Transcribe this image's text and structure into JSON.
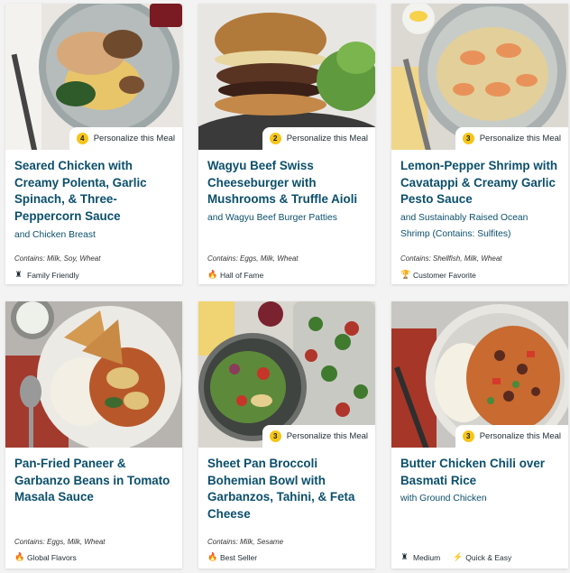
{
  "personalize_label": "Personalize this Meal",
  "colors": {
    "accent": "#0b4f6c",
    "badge": "#f5c518"
  },
  "meals": [
    {
      "count": "4",
      "title": "Seared Chicken with Creamy Polenta, Garlic Spinach, & Three-Peppercorn Sauce",
      "subtitle": "and Chicken Breast",
      "contains": "Contains: Milk, Soy, Wheat",
      "tags": [
        {
          "icon": "chef-hat-icon",
          "label": "Family Friendly"
        }
      ]
    },
    {
      "count": "2",
      "title": "Wagyu Beef Swiss Cheeseburger with Mushrooms & Truffle Aioli",
      "subtitle": "and Wagyu Beef Burger Patties",
      "contains": "Contains: Eggs, Milk, Wheat",
      "tags": [
        {
          "icon": "flame-icon",
          "label": "Hall of Fame"
        }
      ]
    },
    {
      "count": "3",
      "title": "Lemon-Pepper Shrimp with Cavatappi & Creamy Garlic Pesto Sauce",
      "subtitle": "and Sustainably Raised Ocean Shrimp (Contains: Sulfites)",
      "contains": "Contains: Shellfish, Milk, Wheat",
      "tags": [
        {
          "icon": "trophy-icon",
          "label": "Customer Favorite"
        }
      ]
    },
    {
      "count": "",
      "title": "Pan-Fried Paneer & Garbanzo Beans in Tomato Masala Sauce",
      "subtitle": "",
      "contains": "Contains: Eggs, Milk, Wheat",
      "tags": [
        {
          "icon": "flame-icon",
          "label": "Global Flavors"
        }
      ]
    },
    {
      "count": "3",
      "title": "Sheet Pan Broccoli Bohemian Bowl with Garbanzos, Tahini, & Feta Cheese",
      "subtitle": "",
      "contains": "Contains: Milk, Sesame",
      "tags": [
        {
          "icon": "flame-icon",
          "label": "Best Seller"
        }
      ]
    },
    {
      "count": "3",
      "title": "Butter Chicken Chili over Basmati Rice",
      "subtitle": "with Ground Chicken",
      "contains": "",
      "tags": [
        {
          "icon": "chef-hat-icon",
          "label": "Medium"
        },
        {
          "icon": "lightning-icon",
          "label": "Quick & Easy"
        }
      ]
    }
  ]
}
